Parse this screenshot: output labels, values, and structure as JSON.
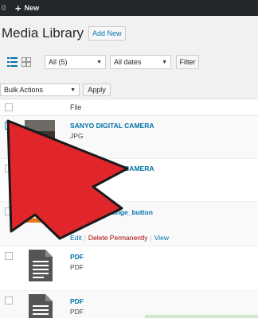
{
  "admin_bar": {
    "count": "0",
    "new_label": "New"
  },
  "header": {
    "title": "Media Library",
    "add_new": "Add New"
  },
  "filters": {
    "type_selected": "All (5)",
    "date_selected": "All dates",
    "filter_button": "Filter"
  },
  "bulk": {
    "selected": "Bulk Actions",
    "apply_button": "Apply"
  },
  "table": {
    "column_file": "File",
    "rows": [
      {
        "name": "SANYO DIGITAL CAMERA",
        "type": "JPG",
        "checked": true
      },
      {
        "name": "SANYO DIGITAL CAMERA",
        "type": "",
        "checked": false
      },
      {
        "name": "download_orange_button",
        "type": "PNG",
        "thumb_text": "Download",
        "checked": false,
        "actions": {
          "edit": "Edit",
          "delete": "Delete Permanently",
          "view": "View"
        }
      },
      {
        "name": "PDF",
        "type": "PDF",
        "checked": false
      },
      {
        "name": "PDF",
        "type": "PDF",
        "checked": false
      }
    ]
  },
  "colors": {
    "admin_bar": "#23282d",
    "link": "#0073aa",
    "delete": "#aa0000",
    "arrow": "#e0262b",
    "orange_button": "#e6771a"
  }
}
